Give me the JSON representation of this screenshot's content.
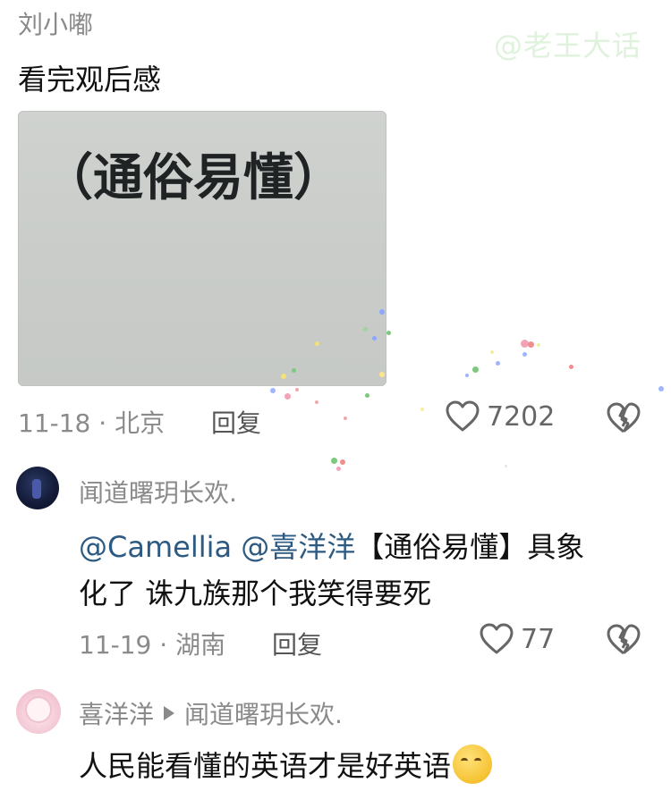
{
  "watermark": "@老王大话",
  "comment1": {
    "author": "刘小嘟",
    "text": "看完观后感",
    "image_text": "（通俗易懂）",
    "date": "11-18",
    "location": "北京",
    "reply_label": "回复",
    "likes": "7202"
  },
  "comment2": {
    "author": "闻道曙玥长欢.",
    "mention1": "@Camellia",
    "mention2": "@喜洋洋",
    "text_part1": "【通俗易懂】具象",
    "text_part2": "化了  诛九族那个我笑得要死",
    "date": "11-19",
    "location": "湖南",
    "reply_label": "回复",
    "likes": "77"
  },
  "comment3": {
    "author": "喜洋洋",
    "reply_to": "闻道曙玥长欢.",
    "text": "人民能看懂的英语才是好英语",
    "emoji": "thinking-face"
  },
  "icons": {
    "like": "heart-outline-icon",
    "dislike": "broken-heart-icon",
    "reply_arrow": "triangle-right-icon"
  },
  "colors": {
    "mention": "#2c5a82",
    "meta_gray": "#8a8a8a"
  }
}
